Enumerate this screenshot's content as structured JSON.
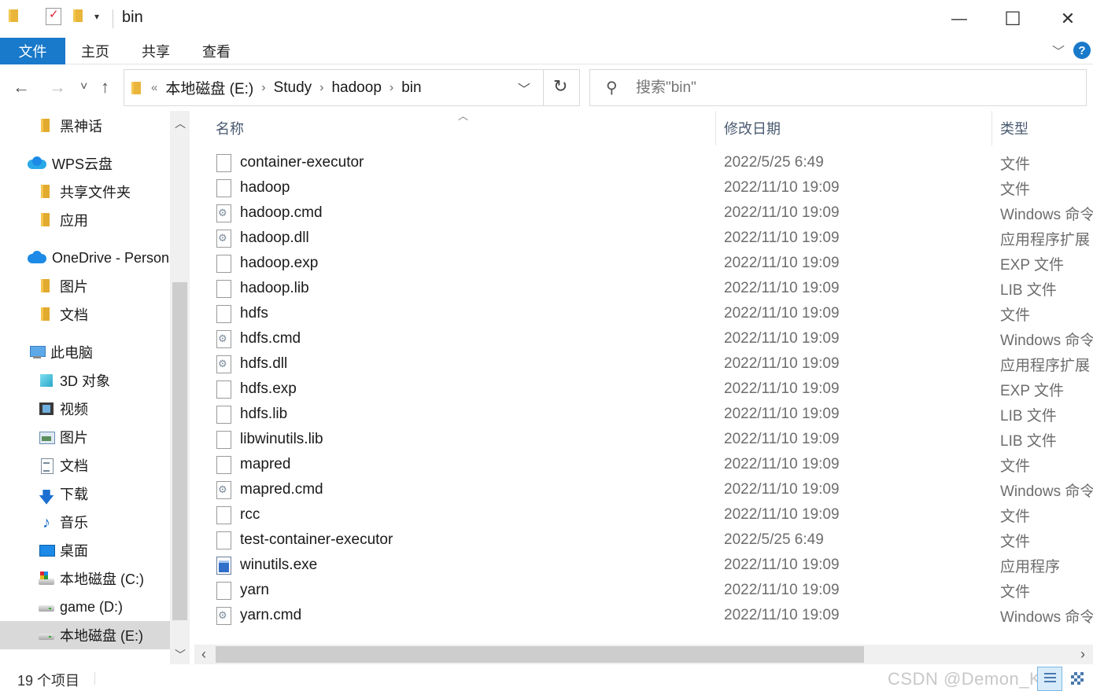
{
  "window": {
    "title": "bin",
    "minimize_glyph": "—",
    "maximize_glyph": "☐",
    "close_glyph": "✕"
  },
  "ribbon": {
    "tabs": [
      {
        "label": "文件",
        "active": true
      },
      {
        "label": "主页"
      },
      {
        "label": "共享"
      },
      {
        "label": "查看"
      }
    ],
    "help_glyph": "?",
    "expand_glyph": "﹀"
  },
  "nav": {
    "back_glyph": "←",
    "forward_glyph": "→",
    "recent_glyph": "˅",
    "up_glyph": "↑",
    "overflow_glyph": "«",
    "crumb_sep": "›",
    "breadcrumbs": [
      "本地磁盘 (E:)",
      "Study",
      "hadoop",
      "bin"
    ],
    "dropdown_glyph": "﹀",
    "refresh_glyph": "↻"
  },
  "search": {
    "placeholder": "搜索\"bin\"",
    "icon_glyph": "⚲"
  },
  "sidebar": {
    "up_arrow": "︿",
    "down_arrow": "﹀",
    "items": [
      {
        "label": "黑神话",
        "icon": "folder-icon"
      },
      {
        "label": "WPS云盘",
        "icon": "cloud-icon"
      },
      {
        "label": "共享文件夹",
        "icon": "folder-icon"
      },
      {
        "label": "应用",
        "icon": "folder-icon"
      },
      {
        "label": "OneDrive - Personal",
        "icon": "cloud-icon"
      },
      {
        "label": "图片",
        "icon": "folder-icon"
      },
      {
        "label": "文档",
        "icon": "folder-icon"
      },
      {
        "label": "此电脑",
        "icon": "computer-icon"
      },
      {
        "label": "3D 对象",
        "icon": "3d-objects-icon"
      },
      {
        "label": "视频",
        "icon": "video-icon"
      },
      {
        "label": "图片",
        "icon": "pictures-icon"
      },
      {
        "label": "文档",
        "icon": "documents-icon"
      },
      {
        "label": "下载",
        "icon": "download-icon",
        "glyph": "🡇"
      },
      {
        "label": "音乐",
        "icon": "music-icon",
        "glyph": "♪"
      },
      {
        "label": "桌面",
        "icon": "desktop-icon"
      },
      {
        "label": "本地磁盘 (C:)",
        "icon": "system-drive-icon"
      },
      {
        "label": "game (D:)",
        "icon": "drive-icon"
      },
      {
        "label": "本地磁盘 (E:)",
        "icon": "drive-icon",
        "selected": true
      }
    ]
  },
  "columns": {
    "name": "名称",
    "date": "修改日期",
    "type": "类型",
    "sort_glyph": "︿"
  },
  "files": [
    {
      "name": "container-executor",
      "date": "2022/5/25 6:49",
      "type": "文件",
      "icon": "file-icon"
    },
    {
      "name": "hadoop",
      "date": "2022/11/10 19:09",
      "type": "文件",
      "icon": "file-icon"
    },
    {
      "name": "hadoop.cmd",
      "date": "2022/11/10 19:09",
      "type": "Windows 命令脚本",
      "icon": "cmd-file-icon"
    },
    {
      "name": "hadoop.dll",
      "date": "2022/11/10 19:09",
      "type": "应用程序扩展",
      "icon": "dll-file-icon"
    },
    {
      "name": "hadoop.exp",
      "date": "2022/11/10 19:09",
      "type": "EXP 文件",
      "icon": "file-icon"
    },
    {
      "name": "hadoop.lib",
      "date": "2022/11/10 19:09",
      "type": "LIB 文件",
      "icon": "file-icon"
    },
    {
      "name": "hdfs",
      "date": "2022/11/10 19:09",
      "type": "文件",
      "icon": "file-icon"
    },
    {
      "name": "hdfs.cmd",
      "date": "2022/11/10 19:09",
      "type": "Windows 命令脚本",
      "icon": "cmd-file-icon"
    },
    {
      "name": "hdfs.dll",
      "date": "2022/11/10 19:09",
      "type": "应用程序扩展",
      "icon": "dll-file-icon"
    },
    {
      "name": "hdfs.exp",
      "date": "2022/11/10 19:09",
      "type": "EXP 文件",
      "icon": "file-icon"
    },
    {
      "name": "hdfs.lib",
      "date": "2022/11/10 19:09",
      "type": "LIB 文件",
      "icon": "file-icon"
    },
    {
      "name": "libwinutils.lib",
      "date": "2022/11/10 19:09",
      "type": "LIB 文件",
      "icon": "file-icon"
    },
    {
      "name": "mapred",
      "date": "2022/11/10 19:09",
      "type": "文件",
      "icon": "file-icon"
    },
    {
      "name": "mapred.cmd",
      "date": "2022/11/10 19:09",
      "type": "Windows 命令脚本",
      "icon": "cmd-file-icon"
    },
    {
      "name": "rcc",
      "date": "2022/11/10 19:09",
      "type": "文件",
      "icon": "file-icon"
    },
    {
      "name": "test-container-executor",
      "date": "2022/5/25 6:49",
      "type": "文件",
      "icon": "file-icon"
    },
    {
      "name": "winutils.exe",
      "date": "2022/11/10 19:09",
      "type": "应用程序",
      "icon": "exe-file-icon"
    },
    {
      "name": "yarn",
      "date": "2022/11/10 19:09",
      "type": "文件",
      "icon": "file-icon"
    },
    {
      "name": "yarn.cmd",
      "date": "2022/11/10 19:09",
      "type": "Windows 命令脚本",
      "icon": "cmd-file-icon"
    }
  ],
  "hscroll": {
    "left_arrow": "‹",
    "right_arrow": "›"
  },
  "status": {
    "item_count": "19 个项目",
    "watermark": "CSDN @Demon_Kirit"
  }
}
